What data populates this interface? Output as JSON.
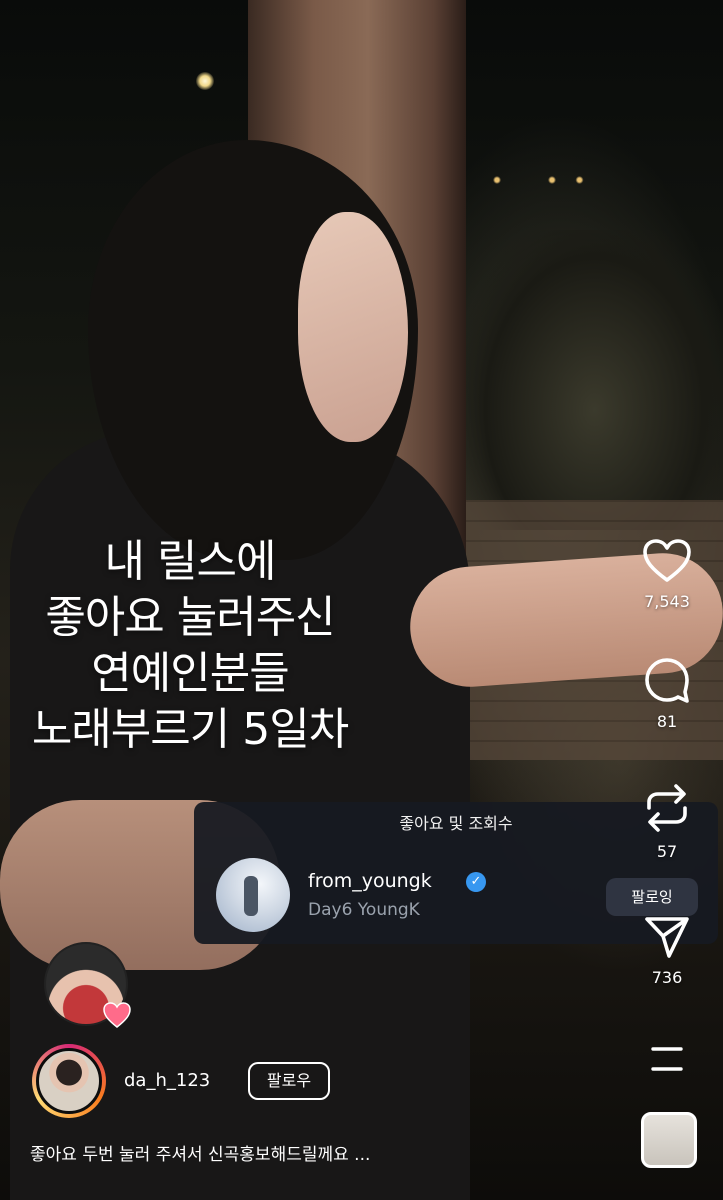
{
  "overlay_caption": {
    "lines": [
      "내 릴스에",
      "좋아요 눌러주신",
      "연예인분들",
      "노래부르기 5일차"
    ]
  },
  "actions": {
    "like": {
      "icon": "heart-icon",
      "count": "7,543"
    },
    "comment": {
      "icon": "comment-icon",
      "count": "81"
    },
    "repost": {
      "icon": "repost-icon",
      "count": "57"
    },
    "share": {
      "icon": "send-icon",
      "count": "736"
    },
    "more": {
      "icon": "more-lines-icon"
    }
  },
  "likes_panel": {
    "title": "좋아요 및 조회수",
    "user": {
      "username": "from_youngk",
      "subtitle": "Day6 YoungK",
      "verified": true,
      "button_label": "팔로잉"
    }
  },
  "author": {
    "username": "da_h_123",
    "follow_label": "팔로우"
  },
  "post_caption": "좋아요 두번 눌러 주셔서 신곡홍보해드릴께요 ...",
  "colors": {
    "panel_bg": "#161921",
    "verified": "#3797f0",
    "heart": "#ff6b8a"
  }
}
